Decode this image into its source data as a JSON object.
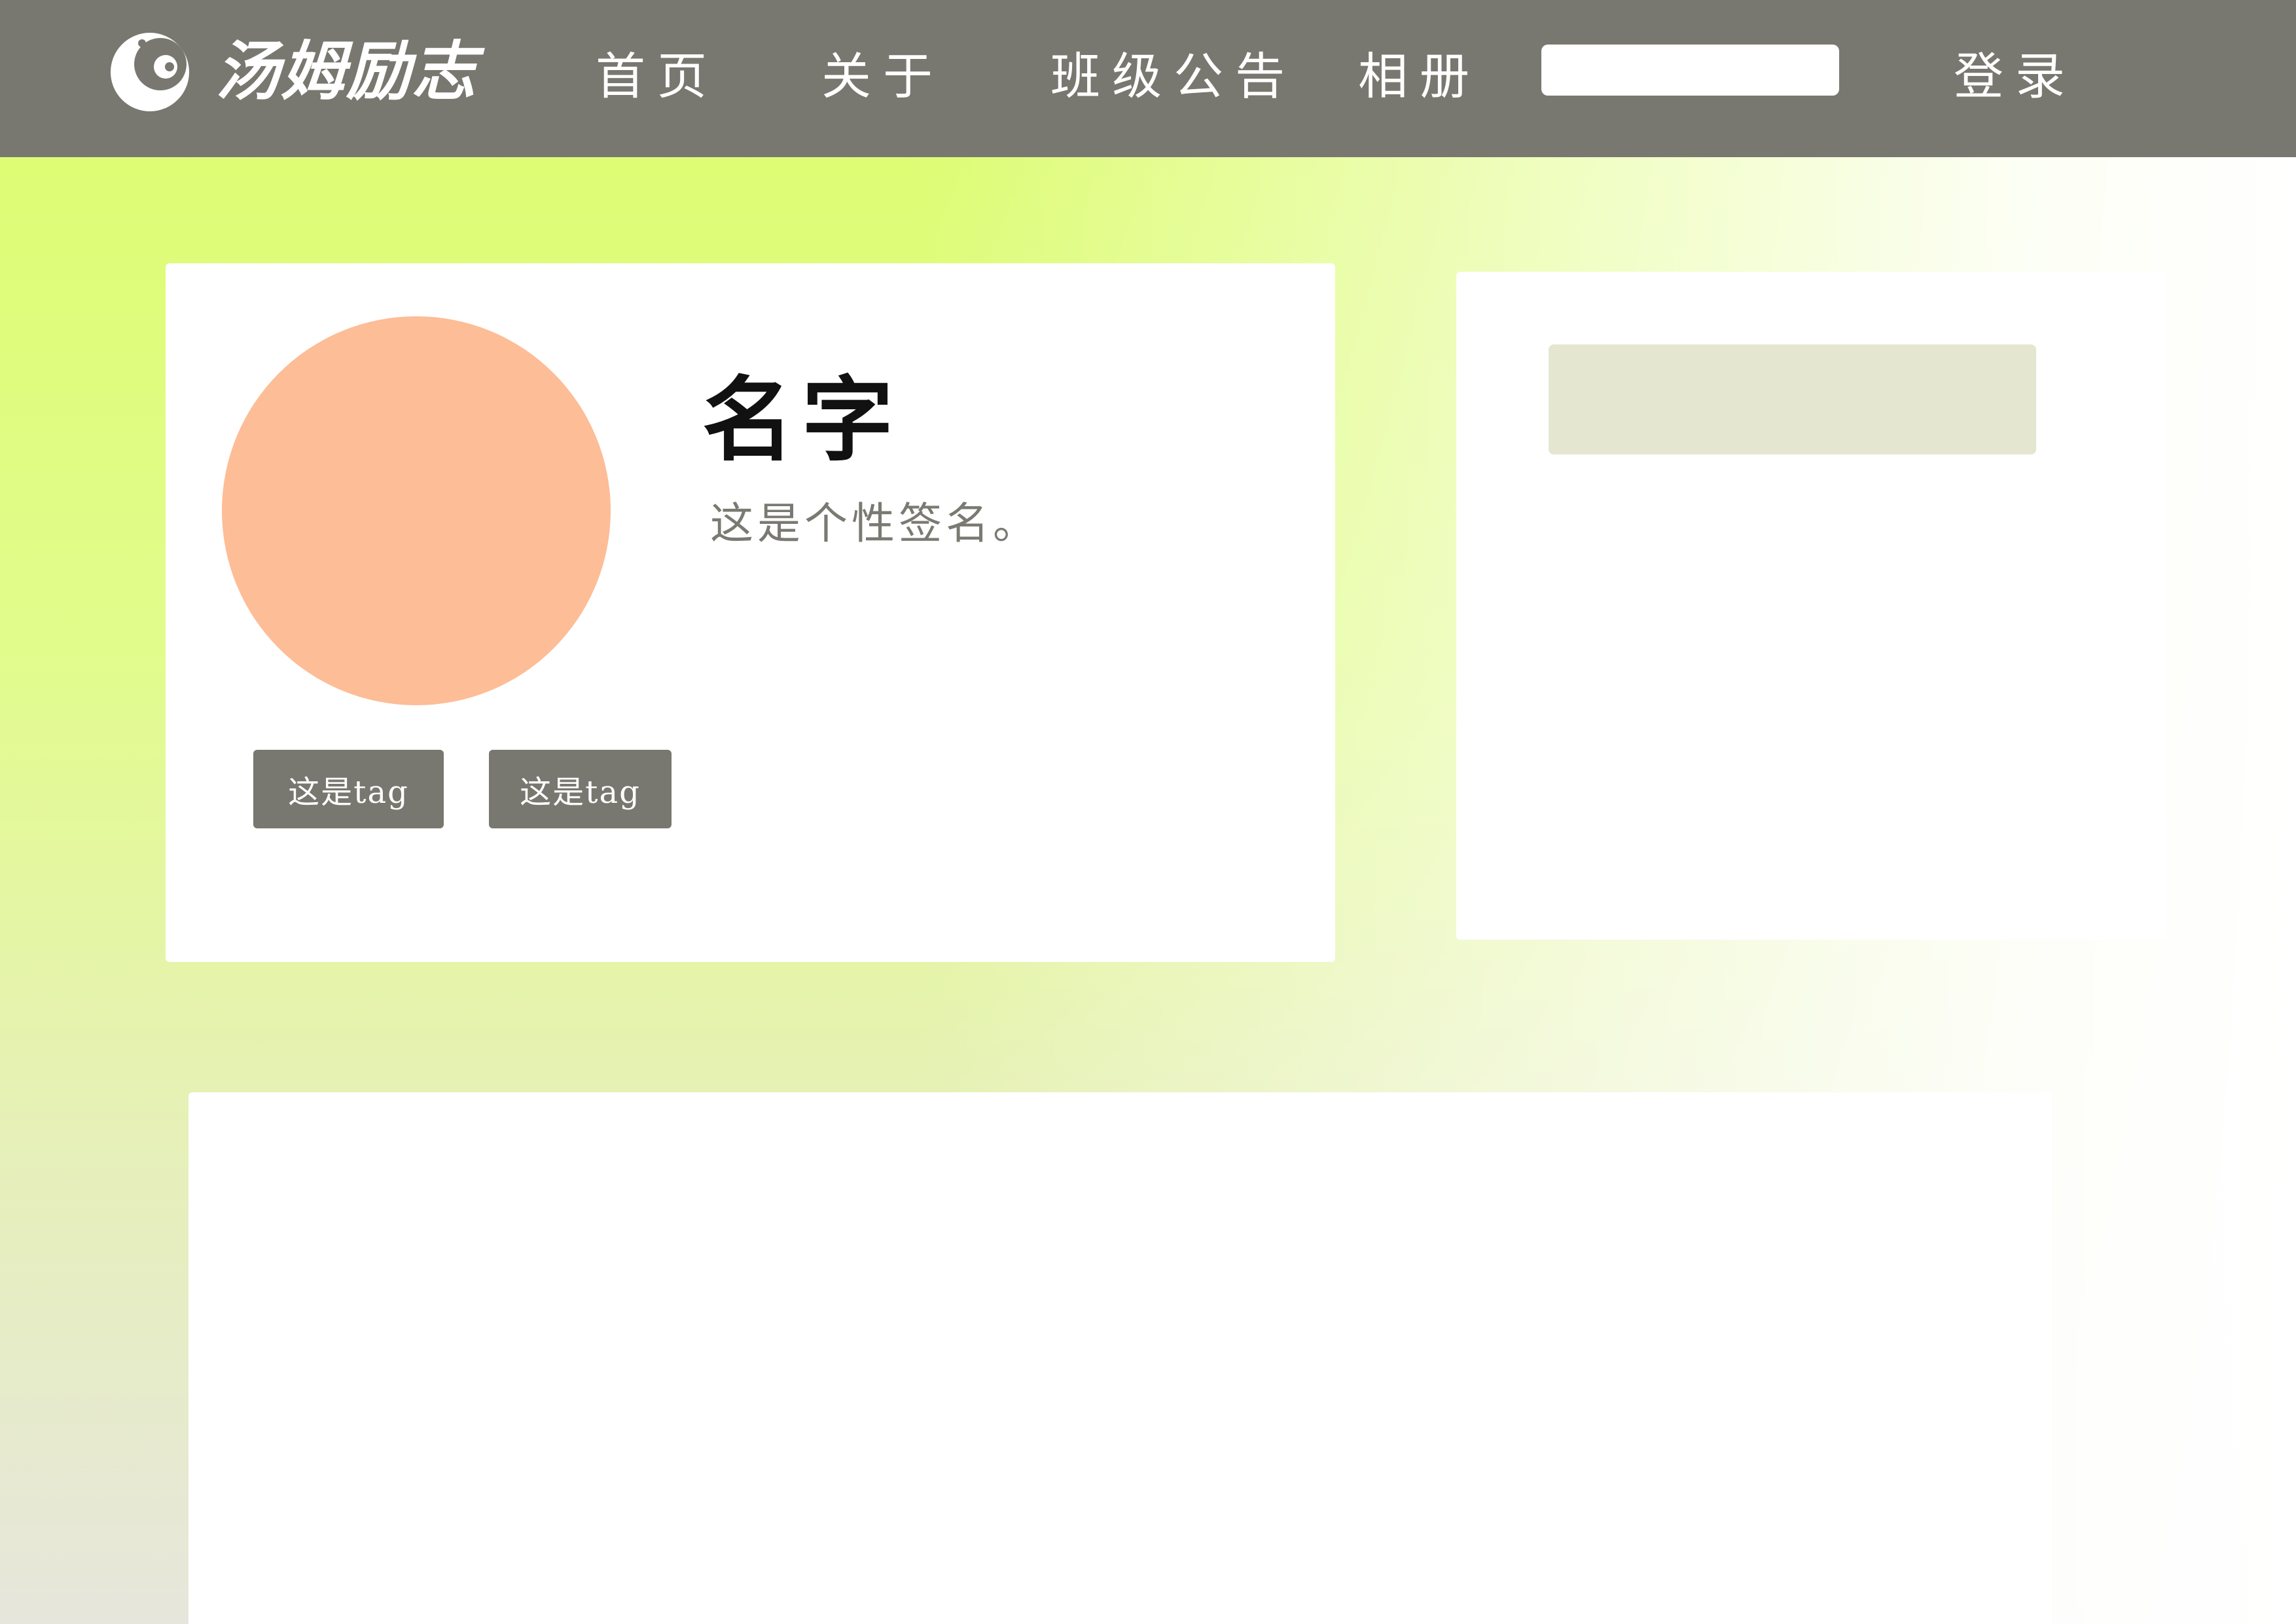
{
  "header": {
    "logo_text": "汤姆励志",
    "nav": {
      "home": "首页",
      "about": "关于",
      "notice": "班级公告",
      "album": "相册",
      "login": "登录"
    },
    "search": {
      "placeholder": ""
    }
  },
  "profile": {
    "name": "名字",
    "signature": "这是个性签名。",
    "tags": [
      "这是tag",
      "这是tag"
    ]
  },
  "colors": {
    "header_bg": "#787870",
    "avatar": "#fdbd96",
    "tag_bg": "#787870",
    "side_block": "#e4e6d0",
    "background_top": "#dcfc6c"
  },
  "icons": {
    "logo": "moon-face-logo-icon"
  }
}
